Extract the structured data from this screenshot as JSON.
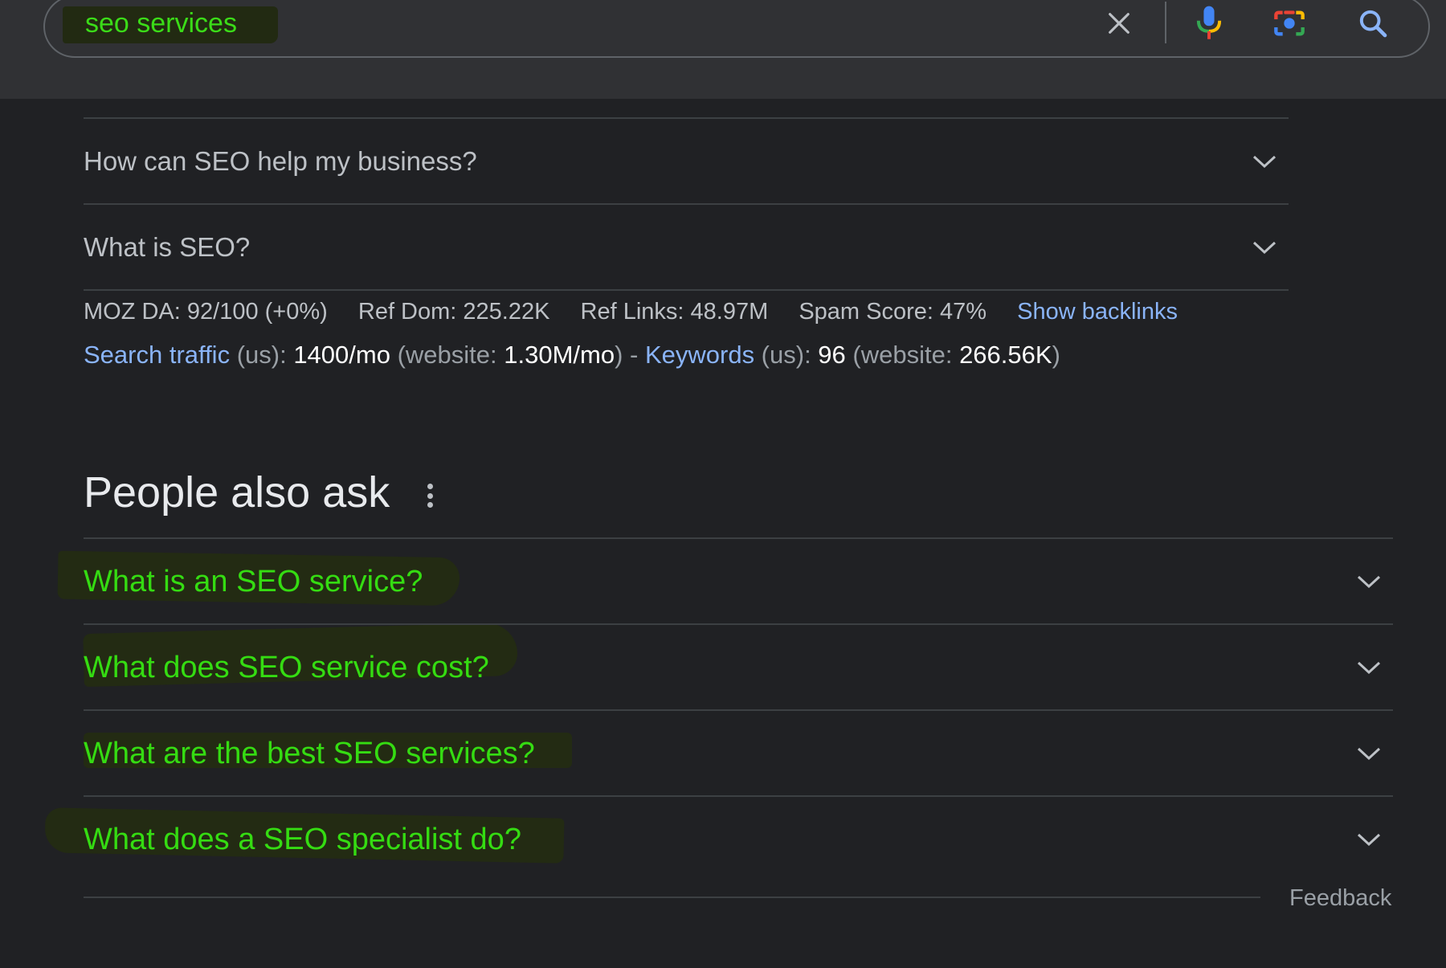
{
  "search": {
    "query": "seo services",
    "icons": [
      "close-icon",
      "microphone-icon",
      "camera-lens-icon",
      "search-icon"
    ]
  },
  "faq": [
    {
      "question": "How can SEO help my business?"
    },
    {
      "question": "What is SEO?"
    }
  ],
  "moz": {
    "da": "MOZ DA: 92/100 (+0%)",
    "ref_dom": "Ref Dom: 225.22K",
    "ref_links": "Ref Links: 48.97M",
    "spam": "Spam Score: 47%",
    "backlinks_link": "Show backlinks"
  },
  "traffic": {
    "search_traffic_label": "Search traffic",
    "us1": " (us): ",
    "traffic_value": "1400/mo",
    "website1_open": " (website: ",
    "website_traffic": "1.30M/mo",
    "website1_close": ") - ",
    "keywords_label": "Keywords",
    "us2": " (us): ",
    "keywords_value": "96",
    "website2_open": " (website: ",
    "website_keywords": "266.56K",
    "website2_close": ")"
  },
  "people_also_ask": {
    "title": "People also ask",
    "questions": [
      "What is an SEO service?",
      "What does SEO service cost?",
      "What are the best SEO services?",
      "What does a SEO specialist do?"
    ]
  },
  "feedback": "Feedback",
  "colors": {
    "background": "#202124",
    "highlight_text": "#35dc12",
    "link": "#8ab4f8"
  }
}
